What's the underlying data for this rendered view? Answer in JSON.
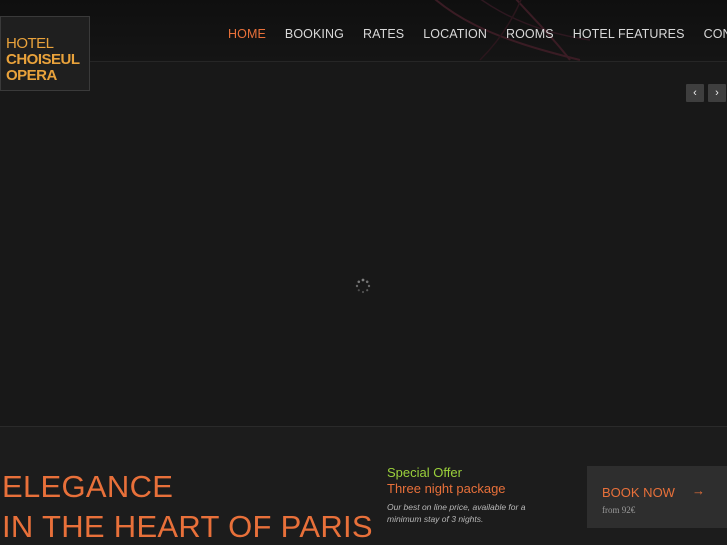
{
  "logo": {
    "line1": "HOTEL",
    "line2": "CHOISEUL",
    "line3": "OPERA"
  },
  "nav": {
    "items": [
      {
        "label": "HOME",
        "active": true
      },
      {
        "label": "BOOKING"
      },
      {
        "label": "RATES"
      },
      {
        "label": "LOCATION"
      },
      {
        "label": "ROOMS"
      },
      {
        "label": "HOTEL FEATURES"
      },
      {
        "label": "CONTACT"
      }
    ]
  },
  "slider": {
    "prev_icon": "chevron-left-icon",
    "next_icon": "chevron-right-icon",
    "prev_glyph": "‹",
    "next_glyph": "›"
  },
  "tagline": {
    "line1": "ELEGANCE",
    "line2": "IN THE HEART OF PARIS"
  },
  "offer": {
    "title": "Special Offer",
    "subtitle": "Three night package",
    "description": "Our best on line price, available for a minimum stay of 3 nights."
  },
  "booknow": {
    "label": "BOOK NOW",
    "arrow": "→",
    "from": "from 92€"
  },
  "colors": {
    "accent": "#e8703a",
    "logo": "#e9a23b",
    "offer_title": "#9bd13b",
    "background": "#1b1b1b"
  }
}
